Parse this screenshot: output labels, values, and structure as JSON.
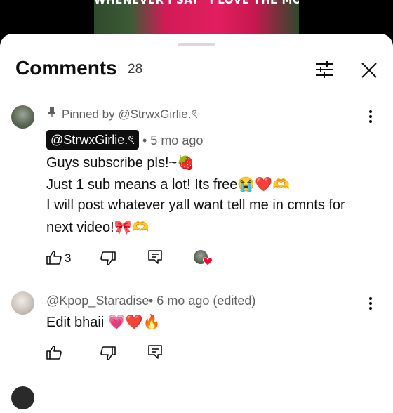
{
  "video": {
    "caption": "WHENEVER I SAY \"I LOVE THE MOON\""
  },
  "header": {
    "title": "Comments",
    "count": "28"
  },
  "comments": [
    {
      "pinned_label": "Pinned by @StrwxGirlie.ৎ",
      "author": "@StrwxGirlie.ৎ",
      "time": "• 5 mo ago",
      "lines": [
        "Guys subscribe pls!~🍓",
        "Just 1 sub means a lot! Its free😭❤️🫶",
        "I will post whatever yall want tell me in cmnts for",
        "next video!🎀🫶"
      ],
      "likes": "3"
    },
    {
      "author": "@Kpop_Staradise",
      "time": "• 6 mo ago (edited)",
      "lines": [
        "Edit bhaii 💗❤️🔥"
      ]
    }
  ],
  "icons": {
    "filter": "filter-sliders-icon",
    "close": "close-icon",
    "more": "more-vert-icon",
    "like": "thumbs-up-icon",
    "dislike": "thumbs-down-icon",
    "reply": "reply-comment-icon",
    "creator_heart": "creator-heart-icon"
  },
  "colors": {
    "chip_bg": "#0f0f0f",
    "heart": "#ff0033",
    "video_accent": "#e11f60"
  }
}
